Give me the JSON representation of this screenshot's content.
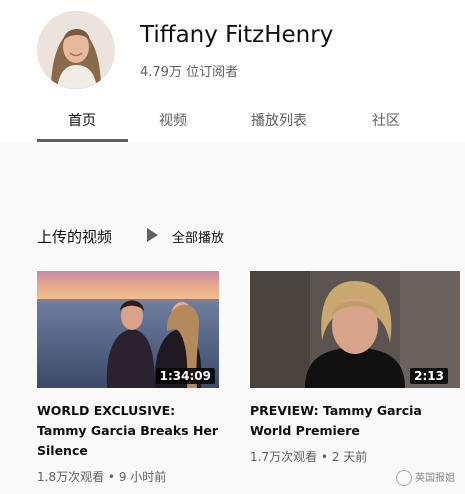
{
  "channel": {
    "name": "Tiffany FitzHenry",
    "subscribers": "4.79万 位订阅者"
  },
  "tabs": [
    {
      "label": "首页",
      "active": true
    },
    {
      "label": "视频",
      "active": false
    },
    {
      "label": "播放列表",
      "active": false
    },
    {
      "label": "社区",
      "active": false
    }
  ],
  "uploads": {
    "title": "上传的视频",
    "play_all": "全部播放"
  },
  "videos": [
    {
      "title": "WORLD EXCLUSIVE: Tammy Garcia Breaks Her Silence",
      "duration": "1:34:09",
      "views": "1.8万次观看",
      "age": "9 小时前"
    },
    {
      "title": "PREVIEW: Tammy Garcia World Premiere",
      "duration": "2:13",
      "views": "1.7万次观看",
      "age": "2 天前"
    }
  ],
  "watermark": "英国报姐"
}
